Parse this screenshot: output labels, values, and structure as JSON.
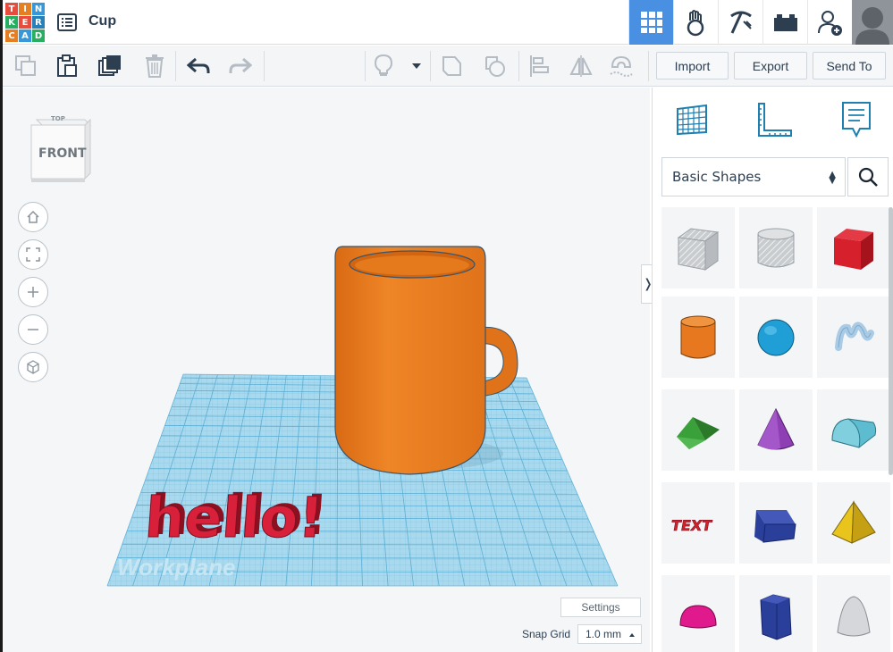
{
  "app": {
    "logo_letters": [
      "T",
      "I",
      "N",
      "K",
      "E",
      "R",
      "C",
      "A",
      "D"
    ],
    "logo_colors": [
      "#e74c3c",
      "#e67e22",
      "#3498db",
      "#27ae60",
      "#e74c3c",
      "#2980b9",
      "#e67e22",
      "#3498db",
      "#27ae60"
    ],
    "design_title": "Cup"
  },
  "topbar": {
    "icons": [
      "3d-design-grid-icon",
      "hand-sim-icon",
      "pickaxe-icon",
      "bricks-icon",
      "add-user-icon"
    ],
    "active": "3d-design-grid-icon"
  },
  "toolbar": {
    "import_label": "Import",
    "export_label": "Export",
    "send_to_label": "Send To"
  },
  "viewport": {
    "viewcube_top": "TOP",
    "viewcube_front": "FRONT",
    "workplane_label": "Workplane",
    "text_shape": "hello!",
    "settings_label": "Settings",
    "snap_grid_label": "Snap Grid",
    "snap_grid_value": "1.0 mm",
    "collapse_glyph": "❭",
    "cup_color": "#e8781f",
    "text_color": "#d8203a",
    "workplane_color": "#a9d9ee"
  },
  "library": {
    "selected": "Basic Shapes",
    "shapes": [
      {
        "name": "box-hole",
        "color": "#b8bcc2"
      },
      {
        "name": "cylinder-hole",
        "color": "#c7cacd"
      },
      {
        "name": "box",
        "color": "#d6202c"
      },
      {
        "name": "cylinder",
        "color": "#e8781f"
      },
      {
        "name": "sphere",
        "color": "#1f9fd6"
      },
      {
        "name": "scribble",
        "color": "#a9cbe6"
      },
      {
        "name": "roof",
        "color": "#3aa03a"
      },
      {
        "name": "cone",
        "color": "#8d3fb3"
      },
      {
        "name": "round-roof",
        "color": "#5dbcd0"
      },
      {
        "name": "text",
        "color": "#d6202c"
      },
      {
        "name": "wedge",
        "color": "#2a3f9a"
      },
      {
        "name": "pyramid",
        "color": "#e8c41c"
      },
      {
        "name": "half-sphere",
        "color": "#e0198c"
      },
      {
        "name": "polygon",
        "color": "#2a3f9a"
      },
      {
        "name": "paraboloid",
        "color": "#d5d7da"
      }
    ],
    "text_shape_label": "TEXT"
  }
}
